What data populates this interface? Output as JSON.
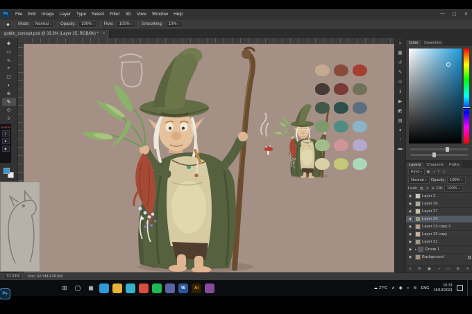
{
  "menu": {
    "logo": "Ps",
    "items": [
      "File",
      "Edit",
      "Image",
      "Layer",
      "Type",
      "Select",
      "Filter",
      "3D",
      "View",
      "Window",
      "Help"
    ]
  },
  "winbtns": {
    "min": "—",
    "max": "▢",
    "close": "✕"
  },
  "options": {
    "brush_glyph": "◉",
    "mode_label": "Mode:",
    "mode": "Normal",
    "opacity_label": "Opacity:",
    "opacity": "100%",
    "flow_label": "Flow:",
    "flow": "100%",
    "smoothing_label": "Smoothing:",
    "smoothing": "10%"
  },
  "doc_tab": {
    "title": "goblin_concept.psd @ 33.3% (Layer 25, RGB/8#) *",
    "close": "×"
  },
  "tools": [
    {
      "name": "move-tool",
      "glyph": "✚"
    },
    {
      "name": "marquee-tool",
      "glyph": "▭"
    },
    {
      "name": "lasso-tool",
      "glyph": "∿"
    },
    {
      "name": "quick-selection-tool",
      "glyph": "⌖"
    },
    {
      "name": "crop-tool",
      "glyph": "▢"
    },
    {
      "name": "eyedropper-tool",
      "glyph": "◗"
    },
    {
      "name": "healing-brush-tool",
      "glyph": "⊕"
    },
    {
      "name": "brush-tool",
      "glyph": "✎"
    },
    {
      "name": "clone-stamp-tool",
      "glyph": "⊙"
    },
    {
      "name": "eraser-tool",
      "glyph": "◊"
    },
    {
      "name": "gradient-tool",
      "glyph": "▨"
    },
    {
      "name": "pen-tool",
      "glyph": "✒"
    },
    {
      "name": "type-tool",
      "glyph": "T"
    },
    {
      "name": "hand-tool",
      "glyph": "◠"
    },
    {
      "name": "zoom-tool",
      "glyph": "◎"
    }
  ],
  "colors": {
    "foreground": "#2d9cdb",
    "background": "#e8e8e8"
  },
  "recorder": {
    "time": "00:48:39",
    "buttons": [
      {
        "name": "pause-button",
        "glyph": "∥"
      },
      {
        "name": "stop-button",
        "glyph": "■"
      },
      {
        "name": "capture-button",
        "glyph": "◉"
      }
    ]
  },
  "panel_strip": [
    {
      "name": "collapse-panels",
      "glyph": "»"
    },
    {
      "name": "navigator-panel",
      "glyph": "▦"
    },
    {
      "name": "history-panel",
      "glyph": "↺"
    },
    {
      "name": "brush-settings-panel",
      "glyph": "✎"
    },
    {
      "name": "clone-source-panel",
      "glyph": "⊙"
    },
    {
      "name": "info-panel",
      "glyph": "ℹ"
    },
    {
      "name": "actions-panel",
      "glyph": "▶"
    },
    {
      "name": "adjustments-panel",
      "glyph": "◩"
    },
    {
      "name": "libraries-panel",
      "glyph": "▤"
    },
    {
      "name": "styles-panel",
      "glyph": "✦"
    },
    {
      "name": "color-wheel-panel",
      "glyph": "◔"
    },
    {
      "name": "timeline-panel",
      "glyph": "▬"
    }
  ],
  "color_panel": {
    "tabs": [
      "Color",
      "Swatches"
    ],
    "selected_color": "#1f9bdc"
  },
  "layers": {
    "tabs": [
      "Layers",
      "Channels",
      "Paths"
    ],
    "kind": "Kind",
    "filter_icons": [
      "▣",
      "◑",
      "T",
      "◻"
    ],
    "blend": "Normal",
    "opacity_label": "Opacity:",
    "opacity": "100%",
    "lock_label": "Lock:",
    "lock_icons": [
      "▨",
      "✛",
      "⊕"
    ],
    "fill_label": "Fill:",
    "fill": "100%",
    "eye_glyph": "◉",
    "group_caret": "▸",
    "rows": [
      {
        "name": "Layer 2",
        "thumb": "#c9c2ba"
      },
      {
        "name": "Layer 26",
        "thumb": "#a8ad90"
      },
      {
        "name": "Layer 27",
        "thumb": "#cdbfae"
      },
      {
        "name": "Layer 25",
        "thumb": "#8f9a7a"
      },
      {
        "name": "Layer 23 copy 2",
        "thumb": "#b59d8b"
      },
      {
        "name": "Layer 22 copy",
        "thumb": "#c2b49e"
      },
      {
        "name": "Layer 21",
        "thumb": "#9f9489"
      },
      {
        "name": "Group 1",
        "thumb": "#5a5a5a"
      },
      {
        "name": "Background",
        "thumb": "#a59086"
      }
    ],
    "footer": [
      {
        "name": "link-layers",
        "glyph": "∞"
      },
      {
        "name": "layer-effects",
        "glyph": "fx"
      },
      {
        "name": "layer-mask",
        "glyph": "▣"
      },
      {
        "name": "adjustment-layer",
        "glyph": "◑"
      },
      {
        "name": "layer-group",
        "glyph": "▭"
      },
      {
        "name": "new-layer",
        "glyph": "⊞"
      },
      {
        "name": "delete-layer",
        "glyph": "✕"
      }
    ]
  },
  "status": {
    "zoom": "33.33%",
    "doc": "Doc: 62.9M/128.5M"
  },
  "canvas": {
    "background": "#a59086",
    "swatches": [
      "#c4a88f",
      "#8a4a3a",
      "#a63f32",
      "#453a35",
      "#7a3a36",
      "#6f7258",
      "#42594a",
      "#2e4f4c",
      "#5d6d7e",
      "#7d9a6d",
      "#4d8d83",
      "#8ab5c9",
      "#a3bd8a",
      "#cf9398",
      "#b4a8cc",
      "#d9d0a8",
      "#c2c878",
      "#abd8ba"
    ]
  },
  "taskbar": {
    "start_glyph": "⊞",
    "search_glyph": "◯",
    "taskview_glyph": "▦",
    "apps": [
      {
        "name": "mail",
        "color": "#2d9cdb",
        "label": ""
      },
      {
        "name": "explorer",
        "color": "#e8b339",
        "label": ""
      },
      {
        "name": "edge",
        "color": "#35b2c9",
        "label": ""
      },
      {
        "name": "chrome",
        "color": "#d94f3d",
        "label": ""
      },
      {
        "name": "spotify",
        "color": "#1db954",
        "label": ""
      },
      {
        "name": "discord",
        "color": "#5865a2",
        "label": ""
      },
      {
        "name": "word",
        "color": "#2b579a",
        "label": "W"
      },
      {
        "name": "photoshop",
        "color": "#0f2a3d",
        "label": "Ps"
      },
      {
        "name": "illustrator",
        "color": "#301f00",
        "label": "Ai"
      },
      {
        "name": "paint",
        "color": "#8a4a9a",
        "label": ""
      }
    ],
    "weather_glyph": "☁",
    "weather": "27°C",
    "tray_icons": [
      {
        "name": "hidden-icons-chevron",
        "glyph": "∧"
      },
      {
        "name": "security-icon",
        "glyph": "◉"
      },
      {
        "name": "volume-icon",
        "glyph": "◖"
      },
      {
        "name": "network-icon",
        "glyph": "≋"
      }
    ],
    "lang": "ENG",
    "time": "15:31",
    "date": "16/10/2021"
  }
}
